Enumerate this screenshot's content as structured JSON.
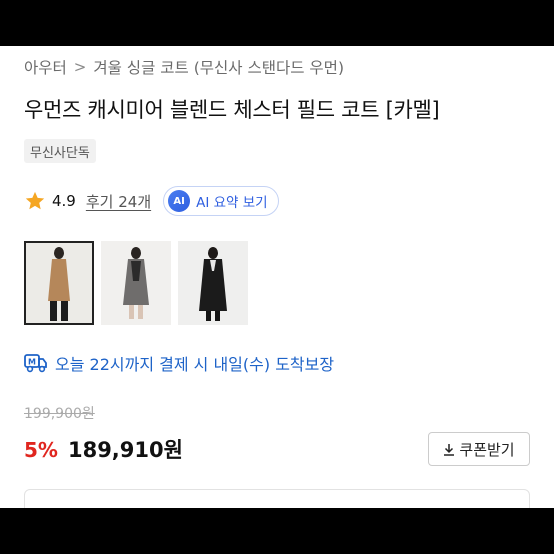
{
  "breadcrumb": {
    "items": [
      "아우터",
      "겨울 싱글 코트 (무신사 스탠다드 우먼)"
    ],
    "separator": ">"
  },
  "product": {
    "title": "우먼즈 캐시미어 블렌드 체스터 필드 코트 [카멜]",
    "badge": "무신사단독"
  },
  "rating": {
    "value": "4.9",
    "review_link": "후기 24개",
    "star_color": "#f5a623",
    "icon": "star-icon"
  },
  "ai_summary": {
    "badge_text": "AI",
    "label": "AI 요약 보기"
  },
  "thumbnails": [
    {
      "coat_color": "camel",
      "selected": true
    },
    {
      "coat_color": "gray",
      "selected": false
    },
    {
      "coat_color": "black",
      "selected": false
    }
  ],
  "delivery": {
    "icon": "delivery-truck-icon",
    "text": "오늘 22시까지 결제 시 내일(수) 도착보장",
    "color": "#1e63c8"
  },
  "pricing": {
    "original_price": "199,900원",
    "discount": "5%",
    "price": "189,910원",
    "discount_color": "#e0261f"
  },
  "coupon": {
    "label": "쿠폰받기",
    "icon": "download-icon"
  }
}
